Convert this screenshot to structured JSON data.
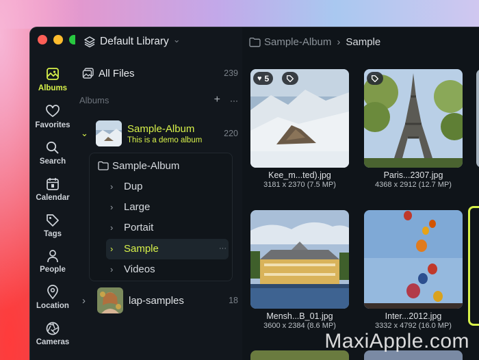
{
  "sidebar_rail": {
    "items": [
      {
        "label": "Albums",
        "icon": "photo-icon",
        "active": true
      },
      {
        "label": "Favorites",
        "icon": "heart-icon"
      },
      {
        "label": "Search",
        "icon": "search-icon"
      },
      {
        "label": "Calendar",
        "icon": "calendar-icon"
      },
      {
        "label": "Tags",
        "icon": "tag-icon"
      },
      {
        "label": "People",
        "icon": "person-icon"
      },
      {
        "label": "Location",
        "icon": "location-pin-icon"
      },
      {
        "label": "Cameras",
        "icon": "aperture-icon"
      }
    ]
  },
  "library": {
    "title": "Default Library",
    "chevron": "⌄"
  },
  "all_files": {
    "label": "All Files",
    "count": "239"
  },
  "albums_section": {
    "label": "Albums",
    "add": "+",
    "more": "···"
  },
  "albums": [
    {
      "name": "Sample-Album",
      "subtitle": "This is a demo album",
      "count": "220"
    },
    {
      "name": "lap-samples",
      "count": "18"
    }
  ],
  "folder_tree": {
    "root": "Sample-Album",
    "children": [
      "Dup",
      "Large",
      "Portait",
      "Sample",
      "Videos"
    ],
    "selected": "Sample",
    "selected_more": "···"
  },
  "breadcrumb": {
    "parent": "Sample-Album",
    "separator": "›",
    "current": "Sample"
  },
  "grid": [
    {
      "name": "Kee_m...ted).jpg",
      "dims": "3181 x 2370 (7.5 MP)",
      "favorites": "5"
    },
    {
      "name": "Paris...2307.jpg",
      "dims": "4368 x 2912 (12.7 MP)"
    },
    {
      "name": "Mensh...B_01.jpg",
      "dims": "3600 x 2384 (8.6 MP)"
    },
    {
      "name": "Inter...2012.jpg",
      "dims": "3332 x 4792 (16.0 MP)"
    }
  ],
  "watermark": "MaxiApple.com",
  "colors": {
    "accent": "#d8f24a",
    "window_bg": "#0f1419",
    "sidebar_bg": "#12171d"
  }
}
